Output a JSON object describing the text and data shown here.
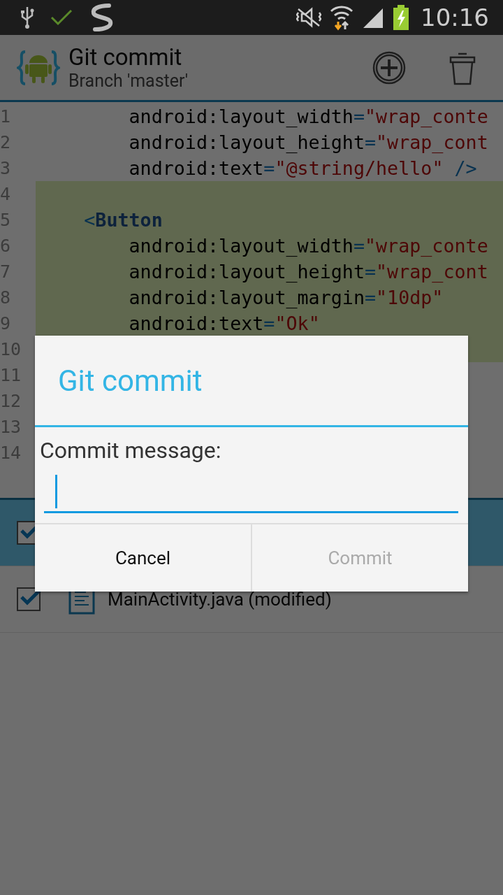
{
  "status_bar": {
    "time": "10:16"
  },
  "action_bar": {
    "title": "Git commit",
    "subtitle": "Branch 'master'"
  },
  "editor": {
    "lines": [
      {
        "number": "1",
        "highlighted": false,
        "tokens": [
          {
            "kind": "attr",
            "text": "        android:layout_width"
          },
          {
            "kind": "punct",
            "text": "="
          },
          {
            "kind": "string",
            "text": "\"wrap_conte"
          }
        ]
      },
      {
        "number": "2",
        "highlighted": false,
        "tokens": [
          {
            "kind": "attr",
            "text": "        android:layout_height"
          },
          {
            "kind": "punct",
            "text": "="
          },
          {
            "kind": "string",
            "text": "\"wrap_cont"
          }
        ]
      },
      {
        "number": "3",
        "highlighted": false,
        "tokens": [
          {
            "kind": "attr",
            "text": "        android:text"
          },
          {
            "kind": "punct",
            "text": "="
          },
          {
            "kind": "string",
            "text": "\"@string/hello\""
          },
          {
            "kind": "punct",
            "text": " />"
          }
        ]
      },
      {
        "number": "4",
        "highlighted": true
      },
      {
        "number": "5",
        "highlighted": true,
        "tokens": [
          {
            "kind": "punct",
            "text": "    <"
          },
          {
            "kind": "tag",
            "text": "Button"
          }
        ]
      },
      {
        "number": "6",
        "highlighted": true,
        "tokens": [
          {
            "kind": "attr",
            "text": "        android:layout_width"
          },
          {
            "kind": "punct",
            "text": "="
          },
          {
            "kind": "string",
            "text": "\"wrap_conte"
          }
        ]
      },
      {
        "number": "7",
        "highlighted": true,
        "tokens": [
          {
            "kind": "attr",
            "text": "        android:layout_height"
          },
          {
            "kind": "punct",
            "text": "="
          },
          {
            "kind": "string",
            "text": "\"wrap_cont"
          }
        ]
      },
      {
        "number": "8",
        "highlighted": true,
        "tokens": [
          {
            "kind": "attr",
            "text": "        android:layout_margin"
          },
          {
            "kind": "punct",
            "text": "="
          },
          {
            "kind": "string",
            "text": "\"10dp\""
          }
        ]
      },
      {
        "number": "9",
        "highlighted": true,
        "tokens": [
          {
            "kind": "attr",
            "text": "        android:text"
          },
          {
            "kind": "punct",
            "text": "="
          },
          {
            "kind": "string",
            "text": "\"Ok\""
          }
        ]
      },
      {
        "number": "10",
        "highlighted": true
      },
      {
        "number": "11",
        "highlighted": false
      },
      {
        "number": "12",
        "highlighted": false
      },
      {
        "number": "13",
        "highlighted": false
      },
      {
        "number": "14",
        "highlighted": false
      }
    ]
  },
  "files": [
    {
      "checked": true,
      "selected": true
    },
    {
      "checked": true,
      "selected": false,
      "name": "MainActivity.java (modified)"
    }
  ],
  "dialog": {
    "title": "Git commit",
    "label": "Commit message:",
    "field": {
      "focused": true
    },
    "buttons": [
      {
        "label": "Cancel",
        "disabled": false
      },
      {
        "label": "Commit",
        "disabled": true
      }
    ]
  }
}
